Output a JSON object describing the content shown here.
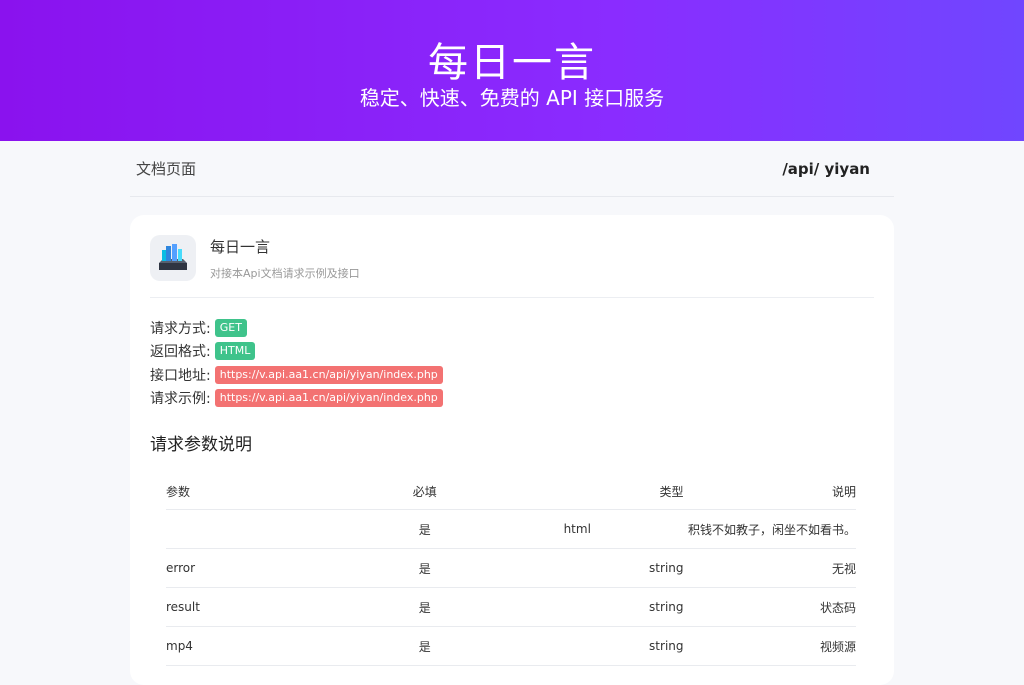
{
  "hero": {
    "title": "每日一言",
    "subtitle": "稳定、快速、免费的 API 接口服务"
  },
  "nav": {
    "doc_label": "文档页面",
    "path": "/api/ yiyan"
  },
  "api": {
    "name": "每日一言",
    "description": "对接本Api文档请求示例及接口",
    "method_label": "请求方式:",
    "method": "GET",
    "format_label": "返回格式:",
    "format": "HTML",
    "url_label": "接口地址:",
    "url": "https://v.api.aa1.cn/api/yiyan/index.php",
    "example_label": "请求示例:",
    "example": "https://v.api.aa1.cn/api/yiyan/index.php"
  },
  "params": {
    "title": "请求参数说明",
    "headers": [
      "参数",
      "必填",
      "类型",
      "说明"
    ],
    "rows": [
      [
        "",
        "是",
        "html",
        "积钱不如教子，闲坐不如看书。"
      ],
      [
        "error",
        "是",
        "string",
        "无视"
      ],
      [
        "result",
        "是",
        "string",
        "状态码"
      ],
      [
        "mp4",
        "是",
        "string",
        "视频源"
      ]
    ]
  },
  "colors": {
    "hero_start": "#8a12ee",
    "hero_end": "#7046ff",
    "tag_green": "#3fc38b",
    "tag_red": "#f37272"
  }
}
